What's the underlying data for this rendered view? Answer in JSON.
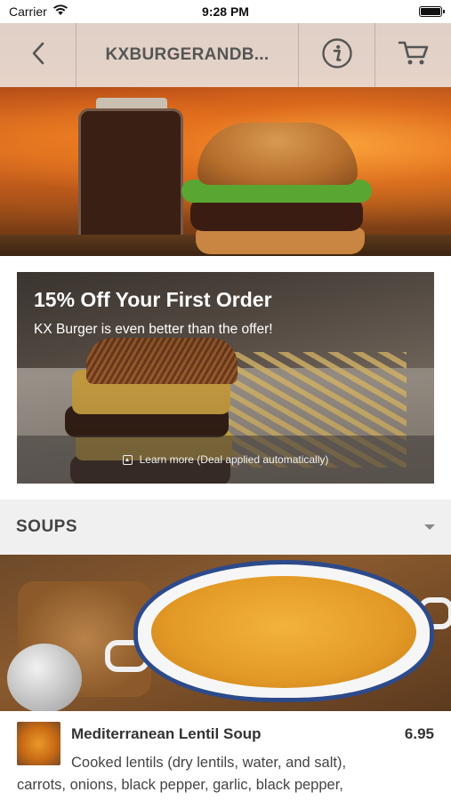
{
  "status_bar": {
    "carrier": "Carrier",
    "time": "9:28 PM"
  },
  "nav": {
    "title": "KXBURGERANDB...",
    "back_icon": "chevron-left-icon",
    "info_icon": "info-icon",
    "cart_icon": "cart-icon"
  },
  "promo": {
    "title": "15% Off Your First Order",
    "subtitle": "KX Burger is even better than the offer!",
    "footer": "Learn more (Deal applied automatically)"
  },
  "category": {
    "title": "SOUPS"
  },
  "item": {
    "name": "Mediterranean Lentil Soup",
    "price": "6.95",
    "desc_line1": "Cooked lentils (dry lentils, water, and salt),",
    "desc_line2": "carrots, onions, black pepper, garlic, black pepper,"
  }
}
